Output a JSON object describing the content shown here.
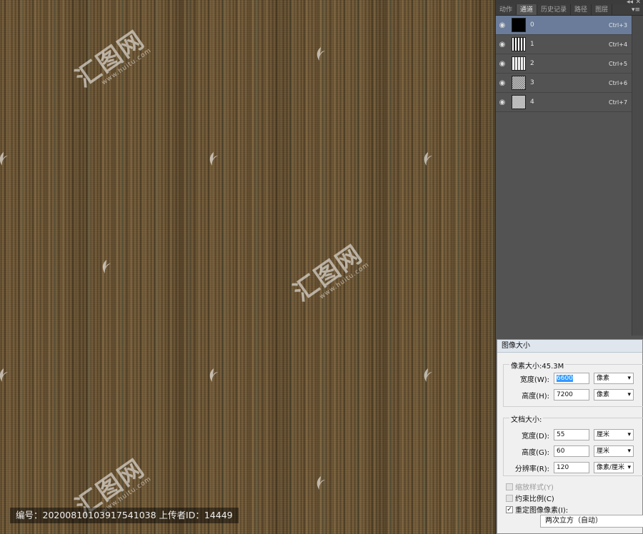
{
  "canvas": {
    "watermark_big": "汇图网",
    "watermark_url": "www.huitu.com",
    "caption": "编号：20200810103917541038 上传者ID：14449"
  },
  "panel": {
    "top_controls": [
      "◂◂",
      "✕"
    ],
    "tabs": [
      "动作",
      "通道",
      "历史记录",
      "路径",
      "图层"
    ],
    "active_tab": "通道",
    "menu_icon": "▾≡",
    "channels": [
      {
        "name": "0",
        "shortcut": "Ctrl+3",
        "selected": true
      },
      {
        "name": "1",
        "shortcut": "Ctrl+4",
        "selected": false
      },
      {
        "name": "2",
        "shortcut": "Ctrl+5",
        "selected": false
      },
      {
        "name": "3",
        "shortcut": "Ctrl+6",
        "selected": false
      },
      {
        "name": "4",
        "shortcut": "Ctrl+7",
        "selected": false
      }
    ]
  },
  "dialog": {
    "title": "图像大小",
    "pixel_size_label": "像素大小:45.3M",
    "width_label": "宽度(W):",
    "width_value": "6600",
    "width_unit": "像素",
    "height_label": "高度(H):",
    "height_value": "7200",
    "height_unit": "像素",
    "doc_size_label": "文档大小:",
    "doc_width_label": "宽度(D):",
    "doc_width_value": "55",
    "doc_width_unit": "厘米",
    "doc_height_label": "高度(G):",
    "doc_height_value": "60",
    "doc_height_unit": "厘米",
    "resolution_label": "分辨率(R):",
    "resolution_value": "120",
    "resolution_unit": "像素/厘米",
    "scale_styles": "缩放样式(Y)",
    "constrain": "约束比例(C)",
    "resample": "重定图像像素(I):",
    "resample_method": "两次立方（自动）"
  }
}
